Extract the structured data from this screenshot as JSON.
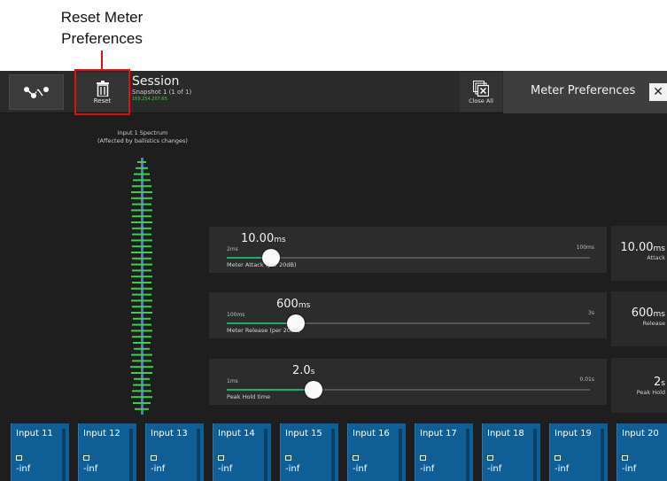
{
  "annotation": {
    "label": "Reset Meter Preferences"
  },
  "topbar": {
    "reset_label": "Reset",
    "session_title": "Session",
    "session_subtitle": "Snapshot 1 (1 of 1)",
    "session_ip": "169.254.207.65",
    "close_all_label": "Close All",
    "meter_prefs_title": "Meter Preferences"
  },
  "spectrum": {
    "title_line1": "Input 1 Spectrum",
    "title_line2": "(Affected by ballistics changes)"
  },
  "prefs": [
    {
      "min": "2ms",
      "max": "100ms",
      "current": "10.00",
      "current_unit": "ms",
      "name": "Meter Attack (per 20dB)",
      "fraction": 0.08
    },
    {
      "min": "100ms",
      "max": "3s",
      "current": "600",
      "current_unit": "ms",
      "name": "Meter Release (per 20dB)",
      "fraction": 0.17
    },
    {
      "min": "1ms",
      "max": "0.01s",
      "current": "2.0",
      "current_unit": "s",
      "name": "Peak Hold time",
      "fraction": 0.22
    }
  ],
  "values": [
    {
      "value": "10.00",
      "unit": "ms",
      "caption": "Attack"
    },
    {
      "value": "600",
      "unit": "ms",
      "caption": "Release"
    },
    {
      "value": "2",
      "unit": "s",
      "caption": "Peak Hold"
    }
  ],
  "channels": [
    {
      "name": "Input 11",
      "level": "-inf"
    },
    {
      "name": "Input 12",
      "level": "-inf"
    },
    {
      "name": "Input 13",
      "level": "-inf"
    },
    {
      "name": "Input 14",
      "level": "-inf"
    },
    {
      "name": "Input 15",
      "level": "-inf"
    },
    {
      "name": "Input 16",
      "level": "-inf"
    },
    {
      "name": "Input 17",
      "level": "-inf"
    },
    {
      "name": "Input 18",
      "level": "-inf"
    },
    {
      "name": "Input 19",
      "level": "-inf"
    },
    {
      "name": "Input 20",
      "level": "-inf"
    }
  ],
  "colors": {
    "accent": "#1ab06a",
    "channel_bg": "#0f5f96",
    "highlight": "#e01010",
    "meter_green": "#3bd14a",
    "meter_blue": "#4a7bd6"
  },
  "icons": [
    "routing-icon",
    "trash-icon",
    "close-all-icon",
    "close-icon"
  ]
}
